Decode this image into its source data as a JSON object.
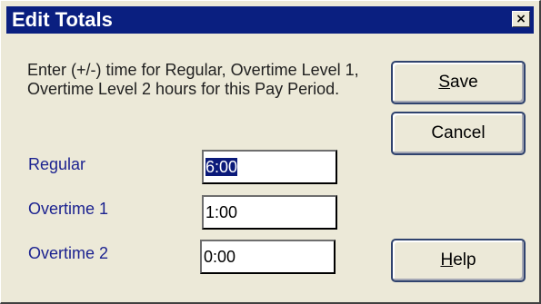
{
  "dialog": {
    "title": "Edit Totals",
    "close_glyph": "×",
    "instructions": "Enter (+/-) time for Regular, Overtime Level 1, Overtime Level 2 hours for this Pay Period."
  },
  "fields": {
    "regular": {
      "label": "Regular",
      "value": "6:00",
      "selected": true
    },
    "overtime1": {
      "label": "Overtime 1",
      "value": "1:00"
    },
    "overtime2": {
      "label": "Overtime 2",
      "value": "0:00"
    }
  },
  "buttons": {
    "save": {
      "accel": "S",
      "rest": "ave"
    },
    "cancel": {
      "label": "Cancel"
    },
    "help": {
      "accel": "H",
      "rest": "elp"
    }
  },
  "colors": {
    "titlebar": "#0a1f80",
    "dialog_bg": "#ece9d8",
    "label_text": "#1c2390",
    "selection": "#0b1a7a"
  },
  "icons": {
    "close": "close-icon"
  }
}
